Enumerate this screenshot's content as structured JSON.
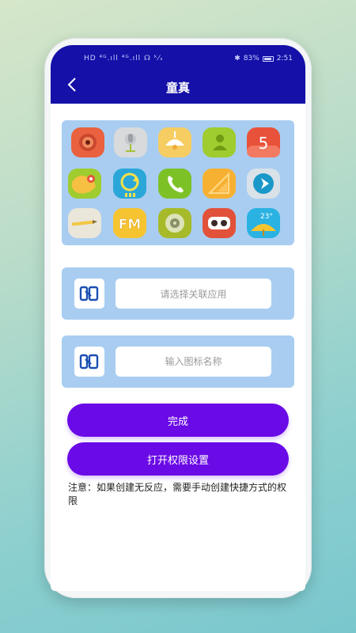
{
  "status_bar": {
    "left_text": "HD ⁴ᴳ.ıll ⁴ᴳ.ıll ☊ ᵏ⁄ₛ",
    "battery_percent": "83%",
    "time": "2:51"
  },
  "header": {
    "title": "童真",
    "back_icon": "chevron-left-icon"
  },
  "icon_grid": {
    "apps": [
      {
        "icon": "camera-app-icon",
        "color": "#e9613f"
      },
      {
        "icon": "microphone-app-icon",
        "color": "#d8dadc"
      },
      {
        "icon": "lamp-app-icon",
        "color": "#f6cd62"
      },
      {
        "icon": "contacts-app-icon",
        "color": "#9fcc2e"
      },
      {
        "icon": "calendar-app-icon",
        "color": "#e9523a",
        "label": "5"
      },
      {
        "icon": "maps-app-icon",
        "color": "#9fcc2e"
      },
      {
        "icon": "update-app-icon",
        "color": "#2aa7d8"
      },
      {
        "icon": "phone-app-icon",
        "color": "#7cc227"
      },
      {
        "icon": "ruler-app-icon",
        "color": "#f7b132"
      },
      {
        "icon": "play-app-icon",
        "color": "#d9e2e8"
      },
      {
        "icon": "notes-app-icon",
        "color": "#eae6da"
      },
      {
        "icon": "fm-radio-app-icon",
        "color": "#f7c431",
        "label": "FM"
      },
      {
        "icon": "music-app-icon",
        "color": "#a7ba2a"
      },
      {
        "icon": "recorder-app-icon",
        "color": "#e2513a"
      },
      {
        "icon": "weather-app-icon",
        "color": "#2ab2e2",
        "label": "23°"
      }
    ]
  },
  "app_select": {
    "logo_icon": "app-logo-icon",
    "placeholder": "请选择关联应用"
  },
  "icon_name": {
    "logo_icon": "app-logo-icon",
    "placeholder": "输入图标名称"
  },
  "buttons": {
    "done_label": "完成",
    "permission_label": "打开权限设置"
  },
  "note": "注意：如果创建无反应，需要手动创建快捷方式的权限",
  "colors": {
    "header": "#1410a8",
    "panel": "#a8cdf1",
    "button": "#6a0ae6"
  }
}
